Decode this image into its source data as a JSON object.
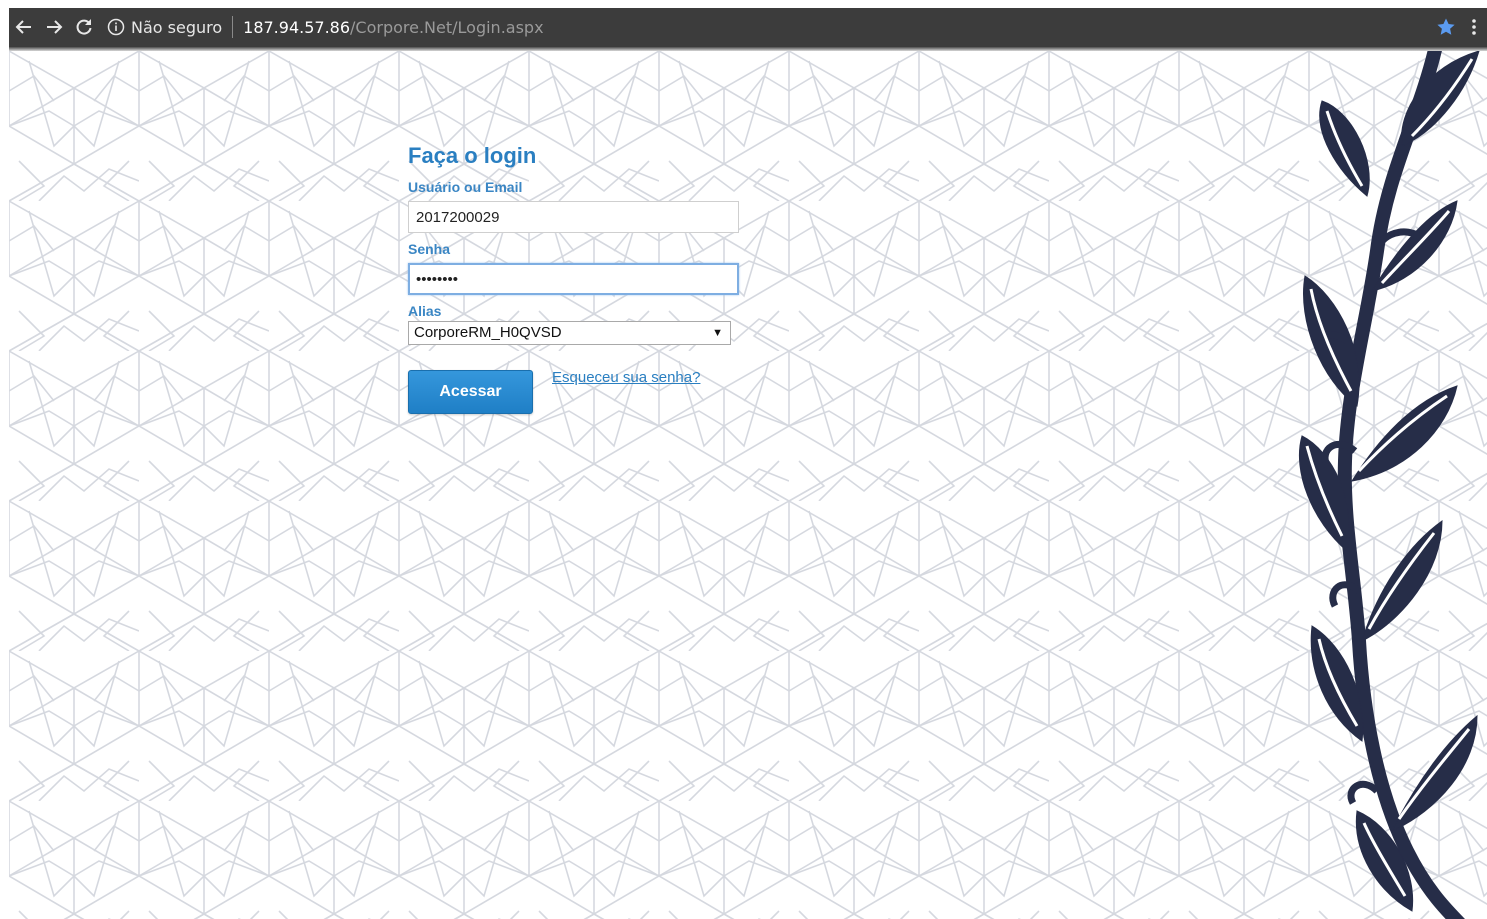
{
  "browser": {
    "security_label": "Não seguro",
    "url_host": "187.94.57.86",
    "url_path": "/Corpore.Net/Login.aspx",
    "icons": [
      "back-arrow-icon",
      "forward-arrow-icon",
      "reload-icon",
      "info-icon",
      "bookmark-star-icon",
      "menu-dots-icon"
    ],
    "colors": {
      "toolbar": "#3c3c3c",
      "star": "#5b9bf0"
    }
  },
  "login": {
    "title": "Faça o login",
    "username_label": "Usuário ou Email",
    "username_value": "2017200029",
    "password_label": "Senha",
    "password_value": "••••••••",
    "alias_label": "Alias",
    "alias_selected": "CorporeRM_H0QVSD",
    "submit_label": "Acessar",
    "forgot_label": "Esqueceu sua senha?"
  },
  "colors": {
    "accent": "#2a7fc1",
    "button": "#2589d0",
    "vine": "#262d48",
    "pattern": "#d5d8df"
  }
}
